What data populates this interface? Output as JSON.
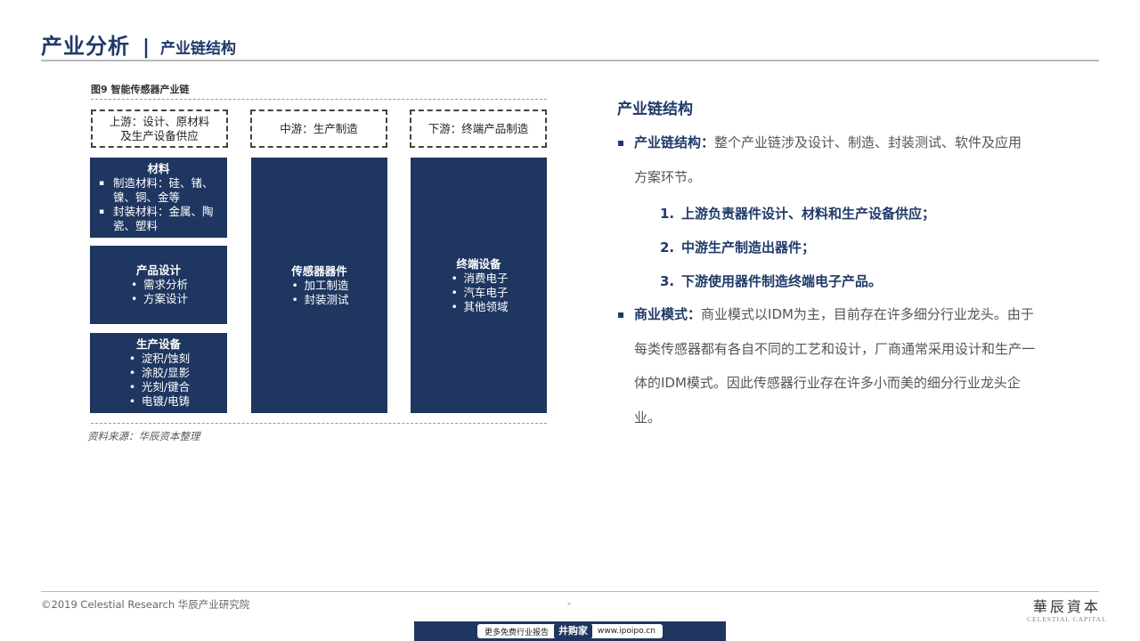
{
  "header": {
    "title": "产业分析",
    "separator": "|",
    "subtitle": "产业链结构"
  },
  "figure": {
    "title": "图9 智能传感器产业链",
    "stages": [
      {
        "line1": "上游：设计、原材料",
        "line2": "及生产设备供应"
      },
      {
        "line1": "中游：生产制造",
        "line2": ""
      },
      {
        "line1": "下游：终端产品制造",
        "line2": ""
      }
    ],
    "upstream_blocks": [
      {
        "title": "材料",
        "items": [
          "制造材料：硅、锗、镍、铜、金等",
          "封装材料：金属、陶瓷、塑料"
        ]
      },
      {
        "title": "产品设计",
        "items": [
          "需求分析",
          "方案设计"
        ]
      },
      {
        "title": "生产设备",
        "items": [
          "淀积/蚀刻",
          "涂胶/显影",
          "光刻/键合",
          "电镀/电铸"
        ]
      }
    ],
    "midstream_block": {
      "title": "传感器器件",
      "items": [
        "加工制造",
        "封装测试"
      ]
    },
    "downstream_block": {
      "title": "终端设备",
      "items": [
        "消费电子",
        "汽车电子",
        "其他领域"
      ]
    },
    "source": "资料来源：华辰资本整理"
  },
  "right": {
    "title": "产业链结构",
    "p1_lead": "产业链结构：",
    "p1_text": "整个产业链涉及设计、制造、封装测试、软件及应用方案环节。",
    "list": [
      {
        "num": "1.",
        "text": "上游负责器件设计、材料和生产设备供应；"
      },
      {
        "num": "2.",
        "text": "中游生产制造出器件；"
      },
      {
        "num": "3.",
        "text": "下游使用器件制造终端电子产品。"
      }
    ],
    "p2_lead": "商业模式：",
    "p2_text": "商业模式以IDM为主，目前存在许多细分行业龙头。由于每类传感器都有各自不同的工艺和设计，厂商通常采用设计和生产一体的IDM模式。因此传感器行业存在许多小而美的细分行业龙头企业。"
  },
  "footer": {
    "copyright": "©2019 Celestial Research 华辰产业研究院",
    "page": "-",
    "logo_cn": "華辰資本",
    "logo_en": "CELESTIAL CAPITAL",
    "banner_left": "更多免费行业报告",
    "banner_brand": "井购家",
    "banner_url": "www.ipoipo.cn"
  },
  "colors": {
    "primary": "#1f3660",
    "heading": "#1f3a68",
    "rule": "#b8b8b8"
  }
}
